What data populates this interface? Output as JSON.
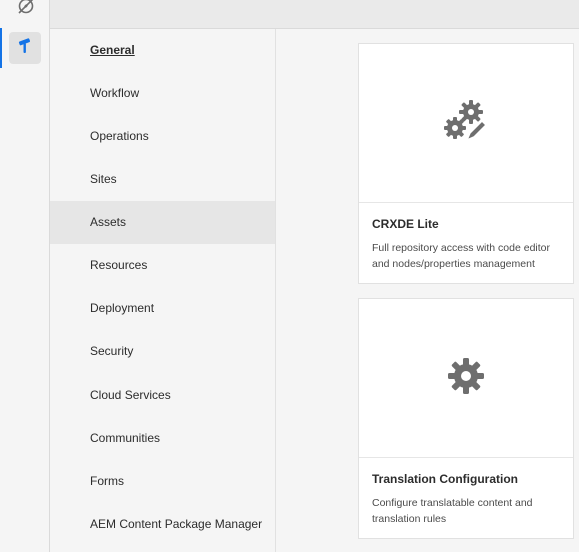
{
  "rail": {
    "icons": [
      "compass-slash-icon",
      "hammer-icon"
    ]
  },
  "nav": {
    "items": [
      {
        "label": "General"
      },
      {
        "label": "Workflow"
      },
      {
        "label": "Operations"
      },
      {
        "label": "Sites"
      },
      {
        "label": "Assets"
      },
      {
        "label": "Resources"
      },
      {
        "label": "Deployment"
      },
      {
        "label": "Security"
      },
      {
        "label": "Cloud Services"
      },
      {
        "label": "Communities"
      },
      {
        "label": "Forms"
      },
      {
        "label": "AEM Content Package Manager"
      }
    ]
  },
  "cards": [
    {
      "icon": "gears-pencil-icon",
      "title": "CRXDE Lite",
      "description": "Full repository access with code editor and nodes/properties management"
    },
    {
      "icon": "gear-icon",
      "title": "Translation Configuration",
      "description": "Configure translatable content and translation rules"
    }
  ],
  "colors": {
    "accent": "#1473e6",
    "icon_gray": "#6e6e6e"
  }
}
